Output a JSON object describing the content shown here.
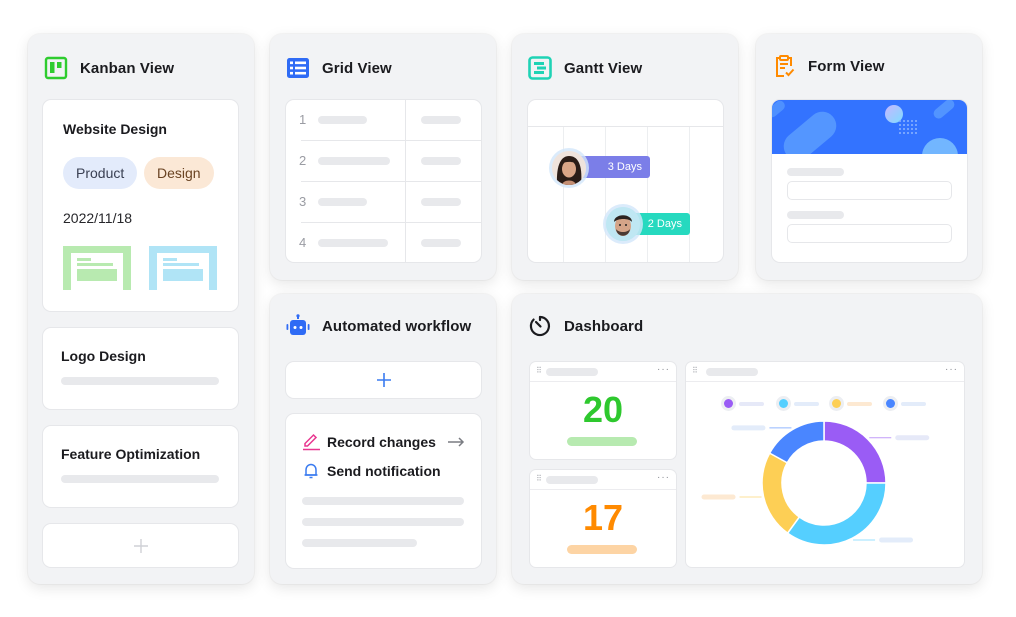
{
  "kanban": {
    "title": "Kanban View",
    "icon": "kanban-board-icon",
    "accent": "#2fcc2f",
    "cards": [
      {
        "title": "Website Design",
        "tags": [
          "Product",
          "Design"
        ],
        "date": "2022/11/18",
        "attachments": [
          "green-attachment-thumbnail",
          "blue-attachment-thumbnail"
        ]
      },
      {
        "title": "Logo Design"
      },
      {
        "title": "Feature Optimization"
      }
    ],
    "add_icon": "plus-icon"
  },
  "grid": {
    "title": "Grid View",
    "icon": "table-list-icon",
    "accent": "#2f6bf5",
    "rows": [
      "1",
      "2",
      "3",
      "4"
    ]
  },
  "gantt": {
    "title": "Gantt View",
    "icon": "gantt-chart-icon",
    "accent": "#1fd3b5",
    "tasks": [
      {
        "label": "3 Days",
        "color": "#7b7ee8",
        "avatar": "woman-avatar"
      },
      {
        "label": "2 Days",
        "color": "#26d9bf",
        "avatar": "man-avatar"
      }
    ]
  },
  "form": {
    "title": "Form View",
    "icon": "clipboard-check-icon",
    "accent": "#ff8a00",
    "banner_color": "#3373ff"
  },
  "workflow": {
    "title": "Automated workflow",
    "icon": "robot-icon",
    "accent": "#2f6bf5",
    "add_icon": "plus-icon",
    "steps": [
      {
        "label": "Record changes",
        "icon": "pencil-icon",
        "color": "#e8368f"
      },
      {
        "label": "Send notification",
        "icon": "bell-icon",
        "color": "#3a7bf0"
      }
    ],
    "arrow_icon": "arrow-right-icon"
  },
  "dashboard": {
    "title": "Dashboard",
    "icon": "timer-icon",
    "stats": [
      {
        "value": "20",
        "color": "#2ec82e",
        "bar_color": "#b7eab0"
      },
      {
        "value": "17",
        "color": "#ff8a00",
        "bar_color": "#fdd4a4"
      }
    ],
    "more_icon": "more-horizontal-icon",
    "grip_icon": "drag-handle-icon"
  },
  "chart_data": {
    "type": "pie",
    "donut": true,
    "title": "",
    "legend_placement": "top",
    "series": [
      {
        "name": "",
        "value": 25,
        "color": "#9a5cf5"
      },
      {
        "name": "",
        "value": 35,
        "color": "#55cfff"
      },
      {
        "name": "",
        "value": 23,
        "color": "#fdcf55"
      },
      {
        "name": "",
        "value": 17,
        "color": "#4a86ff"
      }
    ]
  }
}
